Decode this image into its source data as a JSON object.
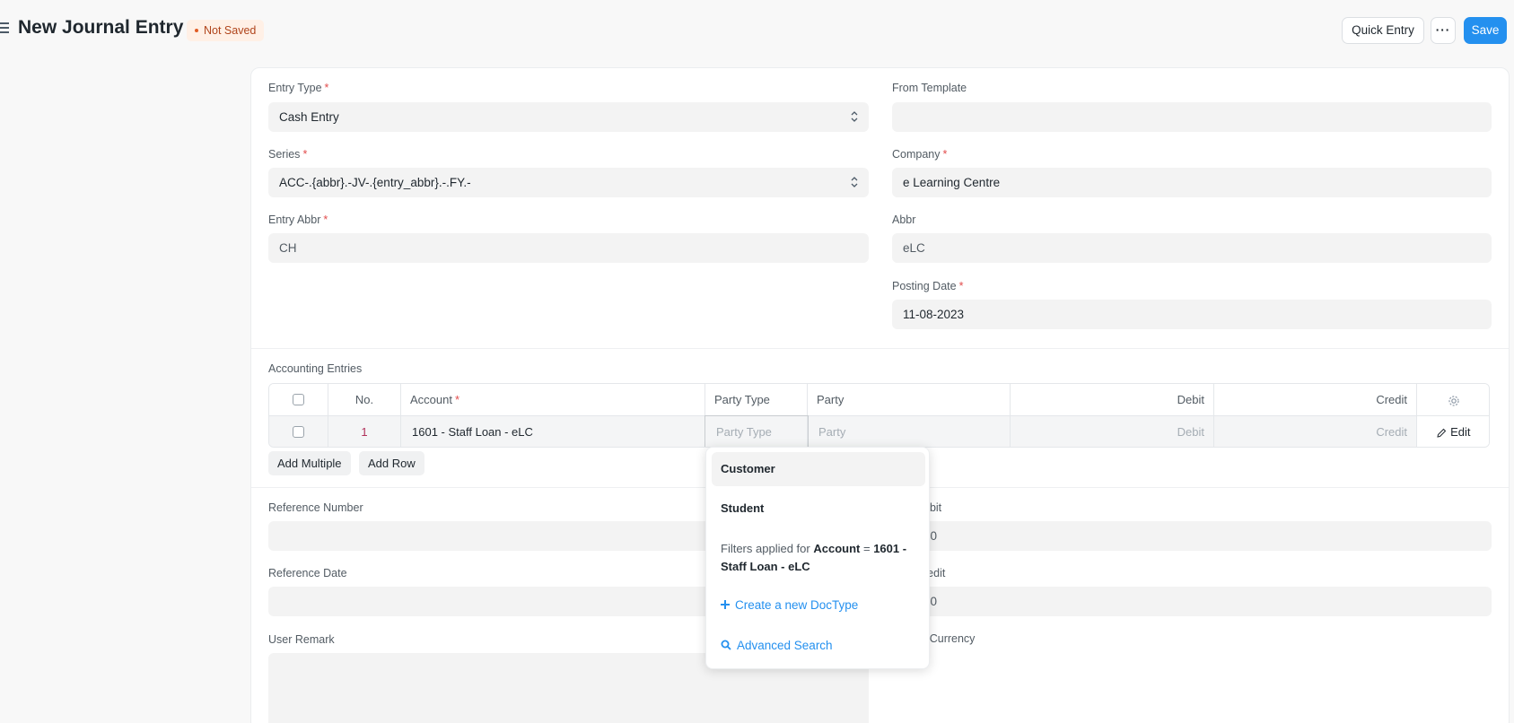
{
  "header": {
    "title": "New Journal Entry",
    "status": "Not Saved",
    "quick_entry_label": "Quick Entry",
    "more_label": "···",
    "save_label": "Save"
  },
  "form": {
    "entry_type": {
      "label": "Entry Type",
      "value": "Cash Entry"
    },
    "series": {
      "label": "Series",
      "value": "ACC-.{abbr}.-JV-.{entry_abbr}.-.FY.-"
    },
    "entry_abbr": {
      "label": "Entry Abbr",
      "value": "CH"
    },
    "from_template": {
      "label": "From Template",
      "value": ""
    },
    "company": {
      "label": "Company",
      "value": "e Learning Centre"
    },
    "abbr": {
      "label": "Abbr",
      "value": "eLC"
    },
    "posting_date": {
      "label": "Posting Date",
      "value": "11-08-2023"
    }
  },
  "accounting": {
    "section_label": "Accounting Entries",
    "columns": {
      "no": "No.",
      "account": "Account",
      "party_type": "Party Type",
      "party": "Party",
      "debit": "Debit",
      "credit": "Credit"
    },
    "rows": [
      {
        "no": "1",
        "account": "1601 - Staff Loan - eLC",
        "party_type_placeholder": "Party Type",
        "party_placeholder": "Party",
        "debit_placeholder": "Debit",
        "credit_placeholder": "Credit",
        "edit_label": "Edit"
      }
    ],
    "add_multiple_label": "Add Multiple",
    "add_row_label": "Add Row"
  },
  "lower": {
    "reference_number": {
      "label": "Reference Number",
      "value": ""
    },
    "reference_date": {
      "label": "Reference Date",
      "value": ""
    },
    "user_remark": {
      "label": "User Remark",
      "value": ""
    },
    "total_debit": {
      "label_visible": "ebit",
      "value_visible": "00"
    },
    "total_credit": {
      "label_visible": "redit",
      "value_visible": "00"
    },
    "multi_currency": {
      "label_visible": "ti Currency"
    }
  },
  "dropdown": {
    "items": [
      "Customer",
      "Student"
    ],
    "filter_prefix": "Filters applied for",
    "filter_field": "Account",
    "filter_eq": "=",
    "filter_value": "1601 - Staff Loan - eLC",
    "create_label": "Create a new DocType",
    "advanced_label": "Advanced Search"
  },
  "colors": {
    "primary": "#2490ef",
    "required": "#e24c4c",
    "not_saved_bg": "#fff0e6",
    "not_saved_text": "#b0441b"
  }
}
